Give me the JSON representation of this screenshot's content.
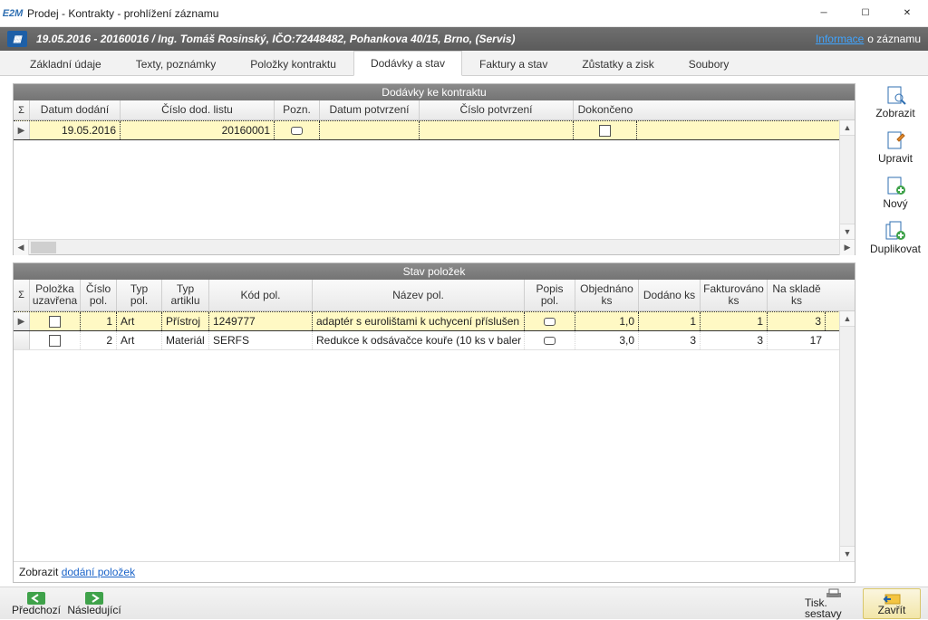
{
  "window": {
    "app_icon_text": "E2M",
    "title": "Prodej - Kontrakty - prohlížení záznamu"
  },
  "header": {
    "text": "19.05.2016 - 20160016 / Ing. Tomáš Rosinský, IČO:72448482, Pohankova 40/15, Brno, (Servis)",
    "link_text": "Informace",
    "link_suffix": "o záznamu"
  },
  "tabs": {
    "items": [
      {
        "label": "Základní údaje"
      },
      {
        "label": "Texty, poznámky"
      },
      {
        "label": "Položky kontraktu"
      },
      {
        "label": "Dodávky a stav"
      },
      {
        "label": "Faktury a stav"
      },
      {
        "label": "Zůstatky a zisk"
      },
      {
        "label": "Soubory"
      }
    ],
    "active_index": 3
  },
  "side_buttons": {
    "show": "Zobrazit",
    "edit": "Upravit",
    "new": "Nový",
    "dup": "Duplikovat"
  },
  "top_grid": {
    "title": "Dodávky ke kontraktu",
    "headers": {
      "sigma": "Σ",
      "date": "Datum dodání",
      "num": "Číslo dod. listu",
      "note": "Pozn.",
      "cdate": "Datum potvrzení",
      "cnum": "Číslo potvrzení",
      "done": "Dokončeno"
    },
    "rows": [
      {
        "date": "19.05.2016",
        "num": "20160001",
        "note": "",
        "cdate": "",
        "cnum": "",
        "done": false
      }
    ]
  },
  "bottom_grid": {
    "title": "Stav položek",
    "headers": {
      "sigma": "Σ",
      "closed": "Položka uzavřena",
      "polno": "Číslo pol.",
      "typpol": "Typ pol.",
      "typart": "Typ artiklu",
      "kod": "Kód pol.",
      "name": "Název pol.",
      "popis": "Popis pol.",
      "obj": "Objednáno ks",
      "dod": "Dodáno ks",
      "fakt": "Fakturováno ks",
      "nask": "Na skladě ks"
    },
    "rows": [
      {
        "closed": false,
        "polno": "1",
        "typpol": "Art",
        "typart": "Přístroj",
        "kod": "1249777",
        "name": "adaptér s eurolištami k uchycení příslušen",
        "popis": "",
        "obj": "1,0",
        "dod": "1",
        "fakt": "1",
        "nask": "3"
      },
      {
        "closed": false,
        "polno": "2",
        "typpol": "Art",
        "typart": "Materiál",
        "kod": "SERFS",
        "name": "Redukce k odsávačce kouře (10 ks v baler",
        "popis": "",
        "obj": "3,0",
        "dod": "3",
        "fakt": "3",
        "nask": "17"
      }
    ],
    "footer_prefix": "Zobrazit ",
    "footer_link": "dodání položek"
  },
  "bottom_bar": {
    "prev": "Předchozí",
    "next": "Následující",
    "print": "Tisk. sestavy",
    "close": "Zavřít"
  }
}
